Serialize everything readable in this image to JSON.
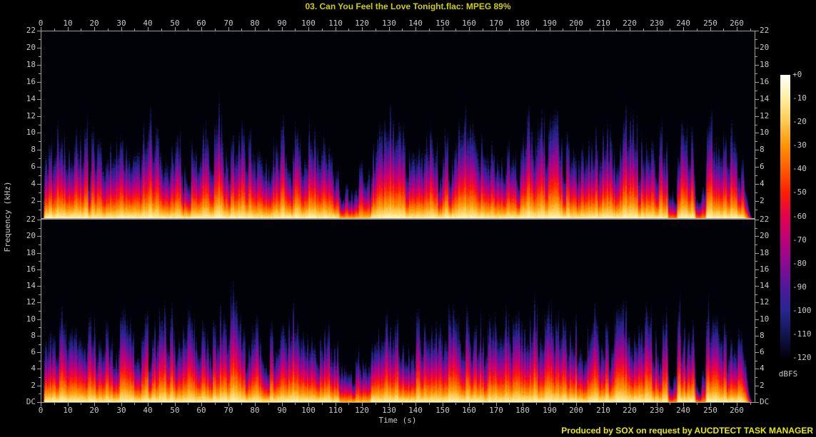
{
  "title": "03. Can You Feel the Love Tonight.flac: MPEG 89%",
  "footer": {
    "credit": "Produced by SOX on request by AUCDTECT TASK MANAGER"
  },
  "colors": {
    "background": "#000000",
    "title_text": "#cfcf00",
    "footer_text": "#e9e900",
    "axis_line": "#a0a0a0",
    "tick_text": "#c8c8c8"
  },
  "chart_data": {
    "type": "heatmap",
    "subtype": "audio-spectrogram-dual-channel",
    "title": "03. Can You Feel the Love Tonight.flac: MPEG 89%",
    "xlabel": "Time (s)",
    "ylabel": "Frequency (kHz)",
    "colorbar_label": "dBFS",
    "x_ticks_s": [
      0,
      10,
      20,
      30,
      40,
      50,
      60,
      70,
      80,
      90,
      100,
      110,
      120,
      130,
      140,
      150,
      160,
      170,
      180,
      190,
      200,
      210,
      220,
      230,
      240,
      250,
      260
    ],
    "x_minor_tick_step_s": 5,
    "x_range_s": [
      0,
      266.7
    ],
    "freq_tick_labels_top_channel": [
      "22",
      "20",
      "18",
      "16",
      "14",
      "12",
      "10",
      "8",
      "6",
      "4",
      "2"
    ],
    "freq_tick_labels_bottom_channel": [
      "22",
      "20",
      "18",
      "16",
      "14",
      "12",
      "10",
      "8",
      "6",
      "4",
      "2",
      "DC"
    ],
    "freq_range_khz": [
      0,
      22
    ],
    "channels": 2,
    "z_range_dbfs": [
      -120,
      0
    ],
    "colorbar_tick_labels": [
      "+0",
      "-10",
      "-20",
      "-30",
      "-40",
      "-50",
      "-60",
      "-70",
      "-80",
      "-90",
      "-100",
      "-110",
      "-120"
    ],
    "legend_position": "right",
    "grid": false,
    "palette_stops": [
      {
        "dbfs": 0,
        "color": "#ffffff"
      },
      {
        "dbfs": -10,
        "color": "#ffef9c"
      },
      {
        "dbfs": -20,
        "color": "#ffc94e"
      },
      {
        "dbfs": -30,
        "color": "#ff9400"
      },
      {
        "dbfs": -40,
        "color": "#ff5c00"
      },
      {
        "dbfs": -50,
        "color": "#ff1e00"
      },
      {
        "dbfs": -60,
        "color": "#e6004e"
      },
      {
        "dbfs": -70,
        "color": "#bc0078"
      },
      {
        "dbfs": -80,
        "color": "#8c0a94"
      },
      {
        "dbfs": -90,
        "color": "#50189c"
      },
      {
        "dbfs": -100,
        "color": "#262690"
      },
      {
        "dbfs": -110,
        "color": "#141452"
      },
      {
        "dbfs": -120,
        "color": "#010108"
      }
    ],
    "audio_profile": {
      "duration_s": 265.5,
      "lead_in_s": [
        0.5,
        1.3
      ],
      "fade_out_s": [
        261.5,
        265.3
      ],
      "quiet_regions": [
        [
          111.5,
          122.5,
          0.55
        ],
        [
          234.3,
          237.0,
          0.3
        ],
        [
          244.5,
          247.8,
          0.3
        ]
      ],
      "typical_reach_khz": 13,
      "lowpass_khz": 16
    }
  }
}
